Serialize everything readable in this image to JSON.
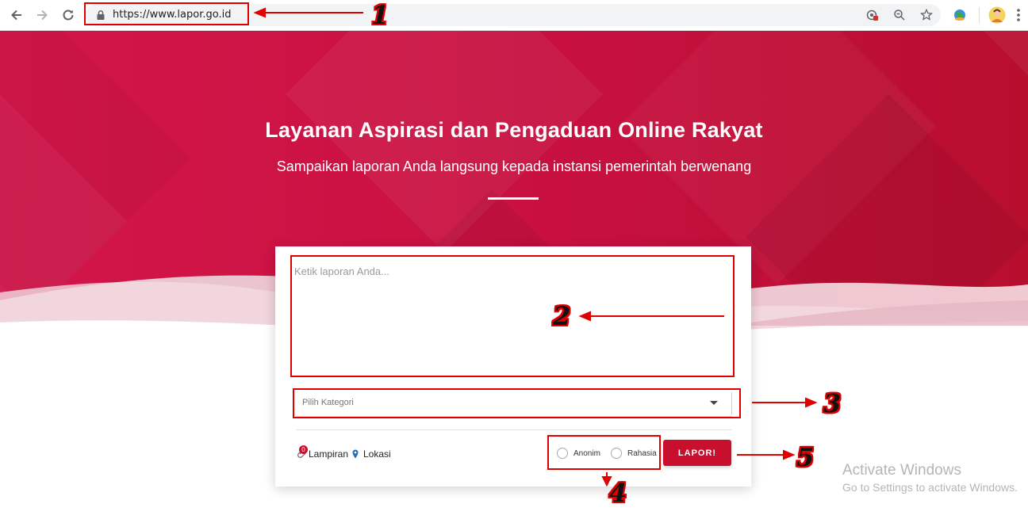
{
  "browser": {
    "url": "https://www.lapor.go.id"
  },
  "hero": {
    "title": "Layanan Aspirasi dan Pengaduan Online Rakyat",
    "subtitle": "Sampaikan laporan Anda langsung kepada instansi pemerintah berwenang"
  },
  "form": {
    "report_placeholder": "Ketik laporan Anda...",
    "category_placeholder": "Pilih Kategori",
    "attachment_label": "Lampiran",
    "attachment_badge": "0",
    "location_label": "Lokasi",
    "anonymous_label": "Anonim",
    "secret_label": "Rahasia",
    "submit_label": "LAPOR!"
  },
  "annotations": {
    "n1": "1",
    "n2": "2",
    "n3": "3",
    "n4": "4",
    "n5": "5"
  },
  "watermark": {
    "title": "Activate Windows",
    "subtitle": "Go to Settings to activate Windows."
  },
  "colors": {
    "brand_red": "#c8102e",
    "annotation_red": "#e00000"
  }
}
